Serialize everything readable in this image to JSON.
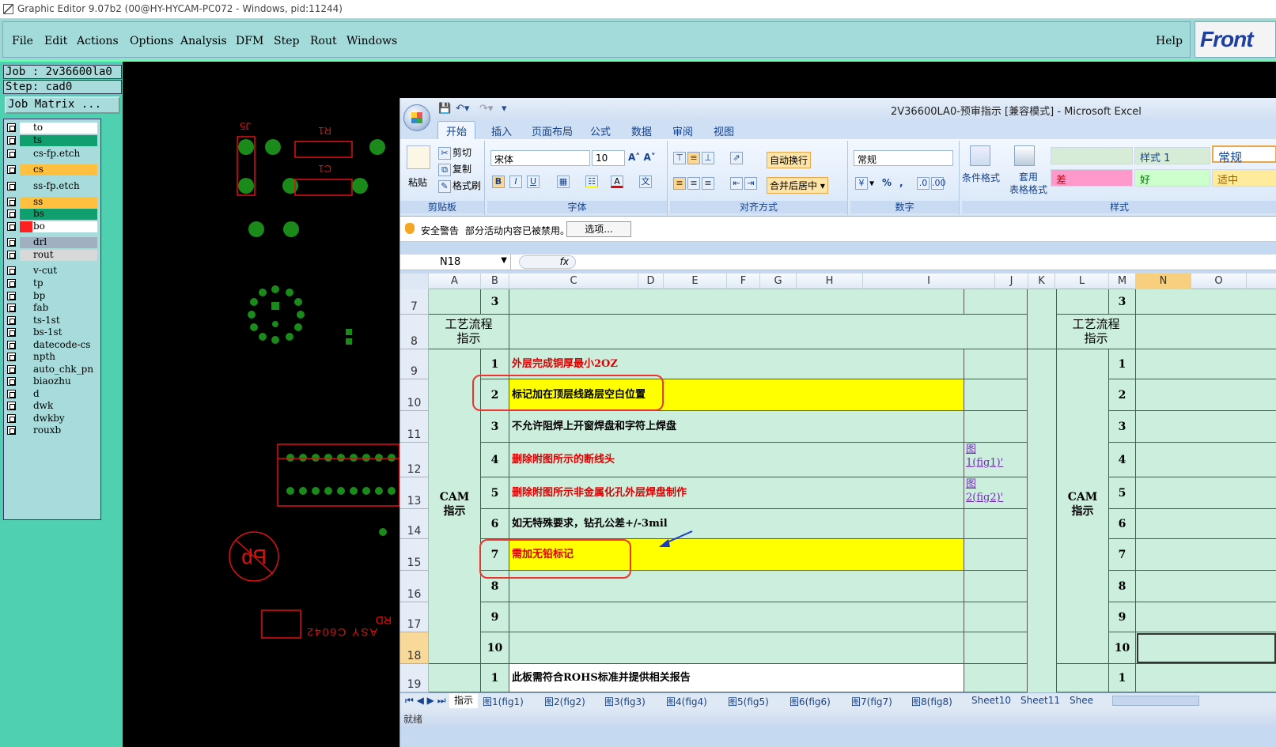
{
  "titlebar": {
    "title": "Graphic Editor 9.07b2 (00@HY-HYCAM-PC072 - Windows, pid:11244)"
  },
  "menubar": {
    "items": [
      {
        "label": "File"
      },
      {
        "label": "Edit"
      },
      {
        "label": "Actions"
      },
      {
        "label": "Options"
      },
      {
        "label": "Analysis"
      },
      {
        "label": "DFM"
      },
      {
        "label": "Step"
      },
      {
        "label": "Rout"
      },
      {
        "label": "Windows"
      }
    ],
    "help": "Help",
    "logo": "Front"
  },
  "leftpanel": {
    "job": "Job : 2v36600la0",
    "step": "Step: cad0",
    "job_matrix": "Job Matrix ...",
    "layers": [
      {
        "name": "to",
        "color": "#ffffff",
        "box": "#ffffff"
      },
      {
        "name": "ts",
        "color": "#10a070",
        "box": "#10a070"
      },
      {
        "name": "cs-fp.etch",
        "color": "#a8dcdc",
        "box": "#a8dcdc"
      },
      {
        "name": "cs",
        "color": "#ffc040",
        "box": "#ffc040"
      },
      {
        "name": "ss-fp.etch",
        "color": "#a8dcdc",
        "box": "#a8dcdc"
      },
      {
        "name": "ss",
        "color": "#ffc040",
        "box": "#ffc040"
      },
      {
        "name": "bs",
        "color": "#10a070",
        "box": "#10a070"
      },
      {
        "name": "bo",
        "color": "#ffffff",
        "box": "#ff2020"
      },
      {
        "name": "drl",
        "color": "#a0b0c0",
        "box": "#a0b0c0"
      },
      {
        "name": "rout",
        "color": "#d8d8d8",
        "box": "#d8d8d8"
      },
      {
        "name": "v-cut",
        "color": "#a8dcdc",
        "box": "#a8dcdc"
      },
      {
        "name": "tp",
        "color": "#a8dcdc",
        "box": "#a8dcdc"
      },
      {
        "name": "bp",
        "color": "#a8dcdc",
        "box": "#a8dcdc"
      },
      {
        "name": "fab",
        "color": "#a8dcdc",
        "box": "#a8dcdc"
      },
      {
        "name": "ts-1st",
        "color": "#a8dcdc",
        "box": "#a8dcdc"
      },
      {
        "name": "bs-1st",
        "color": "#a8dcdc",
        "box": "#a8dcdc"
      },
      {
        "name": "datecode-cs",
        "color": "#a8dcdc",
        "box": "#a8dcdc"
      },
      {
        "name": "npth",
        "color": "#a8dcdc",
        "box": "#a8dcdc"
      },
      {
        "name": "auto_chk_pn",
        "color": "#a8dcdc",
        "box": "#a8dcdc"
      },
      {
        "name": "biaozhu",
        "color": "#a8dcdc",
        "box": "#a8dcdc"
      },
      {
        "name": "d",
        "color": "#a8dcdc",
        "box": "#a8dcdc"
      },
      {
        "name": "dwk",
        "color": "#a8dcdc",
        "box": "#a8dcdc"
      },
      {
        "name": "dwkby",
        "color": "#a8dcdc",
        "box": "#a8dcdc"
      },
      {
        "name": "rouxb",
        "color": "#a8dcdc",
        "box": "#a8dcdc"
      }
    ]
  },
  "pcb": {
    "labels": [
      "J5",
      "R1",
      "C1",
      "ASY C6042",
      "RD"
    ],
    "pb": "Pb"
  },
  "excel": {
    "title": "2V36600LA0-预审指示 [兼容模式] - Microsoft Excel",
    "tabs": [
      "开始",
      "插入",
      "页面布局",
      "公式",
      "数据",
      "审阅",
      "视图"
    ],
    "clipboard": {
      "paste": "粘贴",
      "cut": "剪切",
      "copy": "复制",
      "format_painter": "格式刷",
      "label": "剪贴板"
    },
    "font": {
      "name": "宋体",
      "size": "10",
      "label": "字体",
      "bold": "B",
      "italic": "I",
      "underline": "U"
    },
    "alignment": {
      "wrap": "自动换行",
      "merge": "合并后居中",
      "label": "对齐方式"
    },
    "number": {
      "format": "常规",
      "label": "数字"
    },
    "styles": {
      "cond": "条件格式",
      "table": "套用\n表格格式",
      "label": "样式",
      "style1": "样式 1",
      "normal": "常规",
      "bad": "差",
      "good": "好",
      "neutral": "适中"
    },
    "security": {
      "title": "安全警告",
      "msg": "部分活动内容已被禁用。",
      "options": "选项..."
    },
    "formula_bar": {
      "name_box": "N18",
      "fx": "fx"
    },
    "columns": [
      "A",
      "B",
      "C",
      "D",
      "E",
      "F",
      "G",
      "H",
      "I",
      "J",
      "K",
      "L",
      "M",
      "N",
      "O"
    ],
    "rows": [
      {
        "n": "7",
        "b": "3",
        "c": "",
        "m": "3"
      },
      {
        "n": "8",
        "a": "工艺流程\n指示",
        "l": "工艺流程\n指示"
      },
      {
        "n": "9",
        "b": "1",
        "c": "外层完成铜厚最小2OZ",
        "cls": "red",
        "m": "1"
      },
      {
        "n": "10",
        "b": "2",
        "c": "标记加在顶层线路层空白位置",
        "cls": "blk",
        "fill": "y",
        "m": "2"
      },
      {
        "n": "11",
        "b": "3",
        "c": "不允许阻焊上开窗焊盘和字符上焊盘",
        "cls": "blk",
        "m": "3"
      },
      {
        "n": "12",
        "b": "4",
        "c": "删除附图所示的断线头",
        "cls": "red",
        "j": "图\n1(fig1)'",
        "m": "4"
      },
      {
        "n": "13",
        "b": "5",
        "c": "删除附图所示非金属化孔外层焊盘制作",
        "cls": "red",
        "j": "图\n2(fig2)'",
        "m": "5"
      },
      {
        "n": "14",
        "b": "6",
        "c": "如无特殊要求，钻孔公差+/-3mil",
        "cls": "blk",
        "m": "6"
      },
      {
        "n": "15",
        "b": "7",
        "c": "需加无铅标记",
        "cls": "red",
        "fill": "y",
        "m": "7"
      },
      {
        "n": "16",
        "b": "8",
        "c": "",
        "m": "8"
      },
      {
        "n": "17",
        "b": "9",
        "c": "",
        "m": "9"
      },
      {
        "n": "18",
        "b": "10",
        "c": "",
        "m": "10"
      },
      {
        "n": "19",
        "b": "1",
        "c": "此板需符合ROHS标准并提供相关报告",
        "cls": "blk",
        "fill": "w",
        "m": "1"
      }
    ],
    "cam_label": "CAM\n指示",
    "sheets": [
      "指示",
      "图1(fig1)",
      "图2(fig2)",
      "图3(fig3)",
      "图4(fig4)",
      "图5(fig5)",
      "图6(fig6)",
      "图7(fig7)",
      "图8(fig8)",
      "Sheet10",
      "Sheet11",
      "Shee"
    ],
    "status": "就绪"
  }
}
